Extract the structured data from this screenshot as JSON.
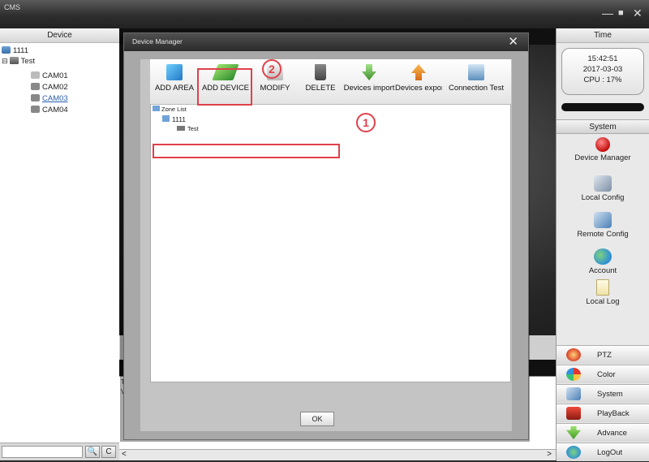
{
  "window": {
    "app_title": "CMS",
    "minimize": "—",
    "maximize": "■",
    "close": "✕"
  },
  "left_panel": {
    "header": "Device",
    "tree": [
      {
        "label": "1111",
        "level": 0
      },
      {
        "label": "Test",
        "level": 0,
        "expander": "⊟"
      },
      {
        "label": "CAM01",
        "level": 1
      },
      {
        "label": "CAM02",
        "level": 1
      },
      {
        "label": "CAM03",
        "level": 1,
        "link": true
      },
      {
        "label": "CAM04",
        "level": 1
      }
    ],
    "search_btn": "🔍",
    "refresh_btn": "C"
  },
  "center": {
    "log_col": "Ty",
    "log_row": "Vi",
    "scroll_left": "<",
    "scroll_right": ">"
  },
  "right_panel": {
    "header": "Time",
    "clock": {
      "time": "15:42:51",
      "date": "2017-03-03",
      "cpu": "CPU : 17%"
    },
    "system_header": "System",
    "items": [
      "Device Manager",
      "Local Config",
      "Remote Config",
      "Account",
      "Local Log"
    ],
    "buttons": [
      "PTZ",
      "Color",
      "System",
      "PlayBack",
      "Advance",
      "LogOut"
    ]
  },
  "dialog": {
    "title": "Device Manager",
    "close": "✕",
    "toolbar": [
      "ADD AREA",
      "ADD DEVICE",
      "MODIFY",
      "DELETE",
      "Devices import",
      "Devices export",
      "Connection Test"
    ],
    "tree": {
      "root": "Zone List",
      "zone": "1111",
      "device": "Test"
    },
    "ok": "OK",
    "annotations": [
      "1",
      "2"
    ]
  }
}
